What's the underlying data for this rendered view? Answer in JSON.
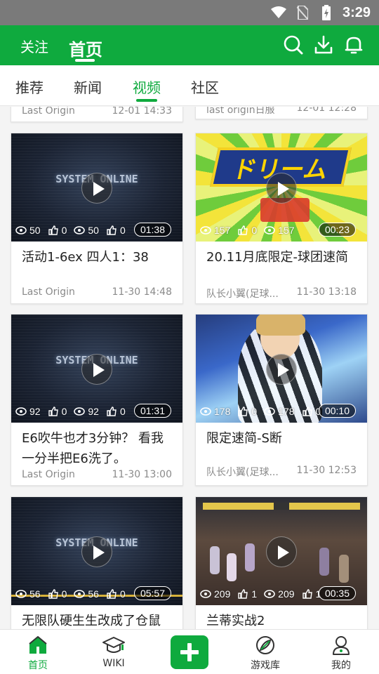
{
  "status_bar": {
    "time": "3:29"
  },
  "header": {
    "follow": "关注",
    "home": "首页"
  },
  "tabs": [
    {
      "label": "推荐",
      "active": false
    },
    {
      "label": "新闻",
      "active": false
    },
    {
      "label": "视频",
      "active": true
    },
    {
      "label": "社区",
      "active": false
    }
  ],
  "feed": {
    "partial": [
      {
        "author": "Last Origin",
        "date": "12-01 14:33"
      },
      {
        "author": "last origin日服",
        "date": "12-01 12:28"
      }
    ],
    "cards": [
      {
        "thumb": "system-online",
        "overlay_text": "SYSTEM ONLINE",
        "views": "50",
        "likes": "0",
        "views2": "50",
        "likes2": "0",
        "duration": "01:38",
        "title": "活动1-6ex 四人1：38",
        "author": "Last Origin",
        "date": "11-30 14:48"
      },
      {
        "thumb": "dream",
        "overlay_text": "ドリーム",
        "views": "157",
        "likes": "0",
        "views2": "157",
        "likes2": "0",
        "duration": "00:23",
        "title": "20.11月底限定-球团速简",
        "author": "队长小翼(足球...",
        "date": "11-30 13:18"
      },
      {
        "thumb": "system-online",
        "overlay_text": "SYSTEM ONLINE",
        "views": "92",
        "likes": "0",
        "views2": "92",
        "likes2": "0",
        "duration": "01:31",
        "title": "E6吹牛也才3分钟？ 看我一分半把E6洗了。",
        "author": "Last Origin",
        "date": "11-30 13:00"
      },
      {
        "thumb": "soccer",
        "overlay_text": "",
        "views": "178",
        "likes": "0",
        "views2": "178",
        "likes2": "0",
        "duration": "00:10",
        "title": "限定速简-S断",
        "author": "队长小翼(足球...",
        "date": "11-30 12:53"
      },
      {
        "thumb": "system-online",
        "overlay_text": "SYSTEM ONLINE",
        "views": "56",
        "likes": "0",
        "views2": "56",
        "likes2": "0",
        "duration": "05:57",
        "title": "无限队硬生生改成了仓鼠",
        "author": "",
        "date": ""
      },
      {
        "thumb": "battle",
        "overlay_text": "",
        "views": "209",
        "likes": "1",
        "views2": "209",
        "likes2": "1",
        "duration": "00:35",
        "title": "兰蒂实战2",
        "author": "",
        "date": ""
      }
    ]
  },
  "bottom_nav": [
    {
      "label": "首页",
      "icon": "home-icon",
      "active": true
    },
    {
      "label": "WIKI",
      "icon": "wiki-cap-icon",
      "active": false
    },
    {
      "label": "",
      "icon": "add-icon",
      "active": false
    },
    {
      "label": "游戏库",
      "icon": "game-library-icon",
      "active": false
    },
    {
      "label": "我的",
      "icon": "profile-icon",
      "active": false
    }
  ],
  "colors": {
    "brand_green": "#0faa3e",
    "status_bar": "#7a7a7a"
  }
}
